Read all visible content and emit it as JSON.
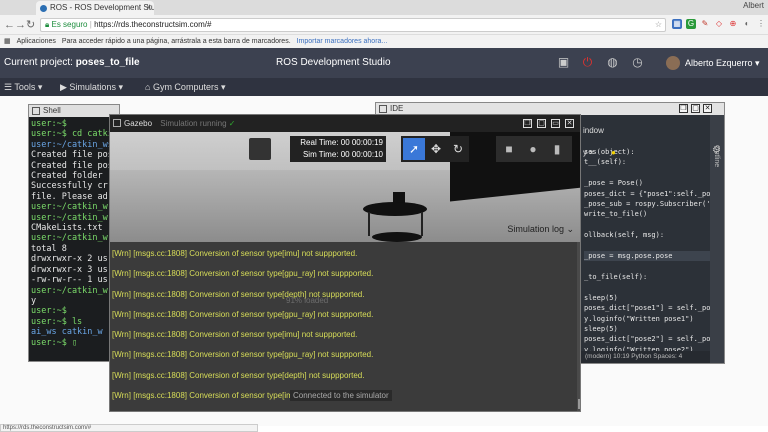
{
  "browser": {
    "tab_title": "ROS - ROS Development Studio",
    "tab_close": "×",
    "profile_name": "Albert",
    "url_secure": "Es seguro",
    "url": "https://rds.theconstructsim.com/#",
    "status_url": "https://rds.theconstructsim.com/#",
    "bookmarks": {
      "apps_label": "Aplicaciones",
      "hint": "Para acceder rápido a una página, arrástrala a esta barra de marcadores.",
      "import_link": "Importar marcadores ahora..."
    }
  },
  "app": {
    "project_prefix": "Current project:",
    "project_name": "poses_to_file",
    "title": "ROS Development Studio",
    "user_name": "Alberto Ezquerro",
    "menu": {
      "tools": "Tools",
      "simulations": "Simulations",
      "gym": "Gym Computers"
    }
  },
  "shell": {
    "title": "Shell",
    "lines": [
      {
        "text": "user:~$",
        "cls": "g"
      },
      {
        "text": "user:~$ cd catkin_ws",
        "cls": "g"
      },
      {
        "text": "user:~/catkin_ws$",
        "cls": "b"
      },
      {
        "text": "Created file poses",
        "cls": "w"
      },
      {
        "text": "Created file poses",
        "cls": "w"
      },
      {
        "text": "Created folder",
        "cls": "w"
      },
      {
        "text": "Successfully cr",
        "cls": "w"
      },
      {
        "text": "file. Please ad",
        "cls": "w"
      },
      {
        "text": "user:~/catkin_w",
        "cls": "g"
      },
      {
        "text": "user:~/catkin_w",
        "cls": "g"
      },
      {
        "text": "CMakeLists.txt",
        "cls": "w"
      },
      {
        "text": "user:~/catkin_w",
        "cls": "g"
      },
      {
        "text": "total 8",
        "cls": "w"
      },
      {
        "text": "drwxrwxr-x 2 us",
        "cls": "w"
      },
      {
        "text": "drwxrwxr-x 3 us",
        "cls": "w"
      },
      {
        "text": "-rw-rw-r-- 1 us",
        "cls": "w"
      },
      {
        "text": "user:~/catkin_w",
        "cls": "g"
      },
      {
        "text": "y",
        "cls": "w"
      },
      {
        "text": "user:~$",
        "cls": "g"
      },
      {
        "text": "user:~$ ls",
        "cls": "g"
      },
      {
        "text": "ai_ws  catkin_w",
        "cls": "b"
      },
      {
        "text": "user:~$ ▯",
        "cls": "g"
      }
    ]
  },
  "ide": {
    "title": "IDE",
    "menu_item": "indow",
    "outline_label": "Outline",
    "status": "(modern)  10:19  Python  Spaces: 4",
    "code_lines": [
      {
        "text": "ses(object):"
      },
      {
        "text": "t__(self):"
      },
      {
        "text": ""
      },
      {
        "text": "_pose = Pose()"
      },
      {
        "text": "poses_dict = {\"pose1\":self._pos"
      },
      {
        "text": "_pose_sub = rospy.Subscriber('/"
      },
      {
        "text": "write_to_file()"
      },
      {
        "text": ""
      },
      {
        "text": "ollback(self, msg):"
      },
      {
        "text": ""
      },
      {
        "text": "_pose = msg.pose.pose"
      },
      {
        "text": ""
      },
      {
        "text": "_to_file(self):"
      },
      {
        "text": ""
      },
      {
        "text": "sleep(5)"
      },
      {
        "text": "poses_dict[\"pose1\"] = self._pos"
      },
      {
        "text": "y.loginfo(\"Written pose1\")"
      },
      {
        "text": "sleep(5)"
      },
      {
        "text": "poses_dict[\"pose2\"] = self._pos"
      },
      {
        "text": "y.loginfo(\"Written pose2\")"
      },
      {
        "text": "sleep(5)"
      }
    ]
  },
  "gazebo": {
    "title": "Gazebo",
    "subtitle": "Simulation running",
    "real_time": "Real Time: 00 00:00:19",
    "sim_time": "Sim Time: 00 00:00:10",
    "simulation_log_label": "Simulation log",
    "loaded_text": "91% loaded",
    "connected_text": "Connected to the simulator",
    "log_lines": [
      "[Wrn] [msgs.cc:1808] Conversion of sensor type[imu] not suppported.",
      "[Wrn] [msgs.cc:1808] Conversion of sensor type[gpu_ray] not suppported.",
      "[Wrn] [msgs.cc:1808] Conversion of sensor type[depth] not suppported.",
      "[Wrn] [msgs.cc:1808] Conversion of sensor type[gpu_ray] not suppported.",
      "[Wrn] [msgs.cc:1808] Conversion of sensor type[imu] not suppported.",
      "[Wrn] [msgs.cc:1808] Conversion of sensor type[gpu_ray] not suppported.",
      "[Wrn] [msgs.cc:1808] Conversion of sensor type[depth] not suppported.",
      "[Wrn] [msgs.cc:1808] Conversion of sensor type[imu] not suppported.",
      "[Wrn] [msgs.cc:1808] Conversion of sensor type[gpu_ray] not suppported."
    ]
  },
  "colors": {
    "app_header": "#3c4150",
    "shell_bg": "#1b1d1f",
    "log_text": "#d8de58",
    "select_tool": "#3a78d8"
  }
}
